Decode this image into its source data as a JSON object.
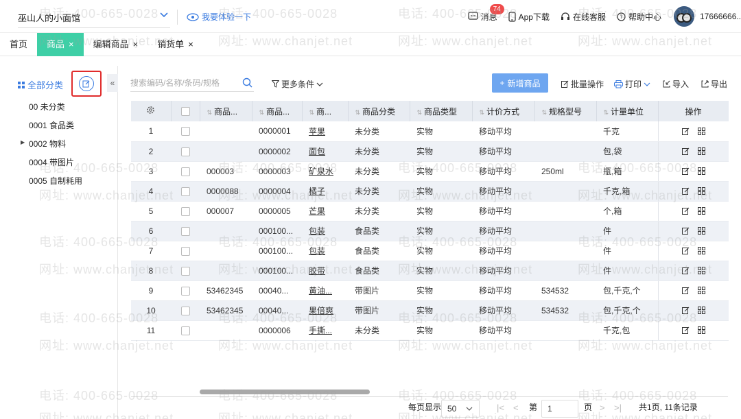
{
  "header": {
    "store_name": "巫山人的小面馆",
    "trial_label": "我要体验一下",
    "messages_label": "消息",
    "messages_badge": "74",
    "app_download": "App下载",
    "online_service": "在线客服",
    "help_center": "帮助中心",
    "username": "17666666..."
  },
  "tabs": [
    {
      "label": "首页"
    },
    {
      "label": "商品"
    },
    {
      "label": "编辑商品"
    },
    {
      "label": "销货单"
    }
  ],
  "sidebar": {
    "all_label": "全部分类",
    "categories": [
      {
        "label": "00 未分类"
      },
      {
        "label": "0001 食品类"
      },
      {
        "label": "0002 物料"
      },
      {
        "label": "0004 带图片"
      },
      {
        "label": "0005 自制耗用"
      }
    ]
  },
  "toolbar": {
    "search_placeholder": "搜索编码/名称/条码/规格",
    "more_conditions": "更多条件",
    "add_product": "新增商品",
    "batch": "批量操作",
    "print": "打印",
    "import": "导入",
    "export": "导出"
  },
  "table": {
    "headers": [
      "商品...",
      "商品...",
      "商...",
      "商品分类",
      "商品类型",
      "计价方式",
      "规格型号",
      "计量单位",
      "操作"
    ],
    "rows": [
      {
        "n": "1",
        "c1": "",
        "c2": "0000001",
        "name": "苹果",
        "cat": "未分类",
        "type": "实物",
        "price": "移动平均",
        "spec": "",
        "unit": "千克"
      },
      {
        "n": "2",
        "c1": "",
        "c2": "0000002",
        "name": "面包",
        "cat": "未分类",
        "type": "实物",
        "price": "移动平均",
        "spec": "",
        "unit": "包,袋"
      },
      {
        "n": "3",
        "c1": "000003",
        "c2": "0000003",
        "name": "矿泉水",
        "cat": "未分类",
        "type": "实物",
        "price": "移动平均",
        "spec": "250ml",
        "unit": "瓶,箱"
      },
      {
        "n": "4",
        "c1": "0000088",
        "c2": "0000004",
        "name": "橘子",
        "cat": "未分类",
        "type": "实物",
        "price": "移动平均",
        "spec": "",
        "unit": "千克,箱"
      },
      {
        "n": "5",
        "c1": "000007",
        "c2": "0000005",
        "name": "芒果",
        "cat": "未分类",
        "type": "实物",
        "price": "移动平均",
        "spec": "",
        "unit": "个,箱"
      },
      {
        "n": "6",
        "c1": "",
        "c2": "000100...",
        "name": "包装",
        "cat": "食品类",
        "type": "实物",
        "price": "移动平均",
        "spec": "",
        "unit": "件"
      },
      {
        "n": "7",
        "c1": "",
        "c2": "000100...",
        "name": "包装",
        "cat": "食品类",
        "type": "实物",
        "price": "移动平均",
        "spec": "",
        "unit": "件"
      },
      {
        "n": "8",
        "c1": "",
        "c2": "000100...",
        "name": "胶带",
        "cat": "食品类",
        "type": "实物",
        "price": "移动平均",
        "spec": "",
        "unit": "件"
      },
      {
        "n": "9",
        "c1": "53462345",
        "c2": "00040...",
        "name": "黄油...",
        "cat": "带图片",
        "type": "实物",
        "price": "移动平均",
        "spec": "534532",
        "unit": "包,千克,个"
      },
      {
        "n": "10",
        "c1": "53462345",
        "c2": "00040...",
        "name": "果倍爽",
        "cat": "带图片",
        "type": "实物",
        "price": "移动平均",
        "spec": "534532",
        "unit": "包,千克,个"
      },
      {
        "n": "11",
        "c1": "",
        "c2": "0000006",
        "name": "手撕...",
        "cat": "未分类",
        "type": "实物",
        "price": "移动平均",
        "spec": "",
        "unit": "千克,包"
      }
    ]
  },
  "pagination": {
    "per_page_label": "每页显示",
    "per_page_value": "50",
    "page_prefix": "第",
    "page_value": "1",
    "page_suffix": "页",
    "summary": "共1页, 11条记录"
  },
  "watermark": {
    "phone": "电话: 400-665-0028",
    "site": "网址: www.chanjet.net"
  },
  "colors": {
    "accent_tab": "#3ecfa6",
    "link_blue": "#3a7be0",
    "add_button": "#6ea6f0",
    "highlight_box": "#e02b2b"
  }
}
